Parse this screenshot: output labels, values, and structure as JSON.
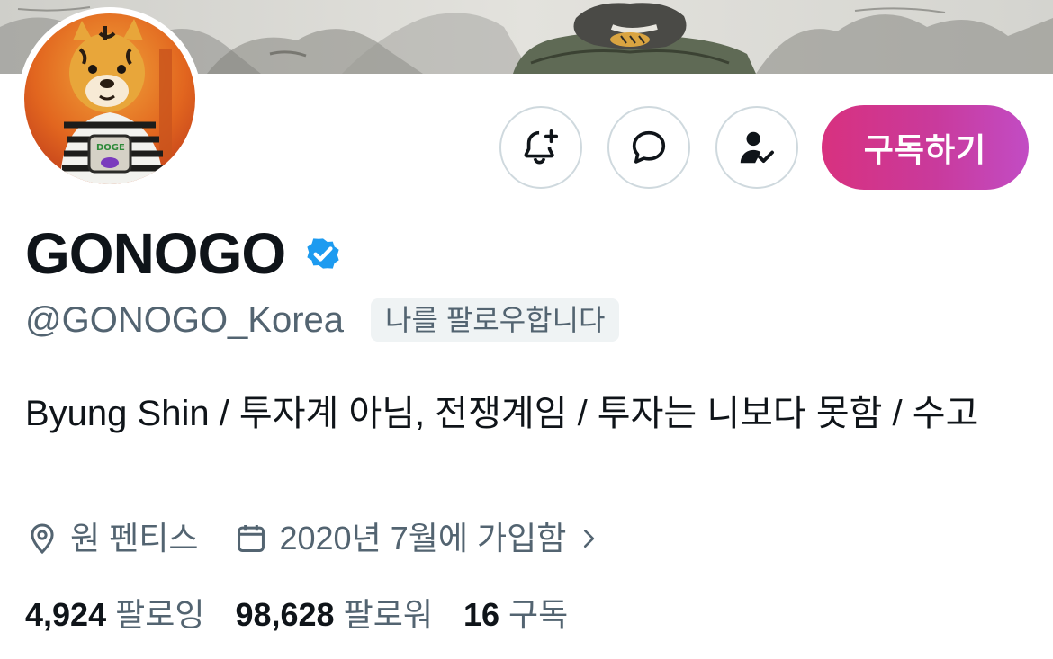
{
  "profile": {
    "display_name": "GONOGO",
    "handle": "@GONOGO_Korea",
    "follows_you_badge": "나를 팔로우합니다",
    "bio": "Byung Shin / 투자계 아님, 전쟁계임 / 투자는 니보다 못함 / 수고",
    "location": "원 펜티스",
    "joined": "2020년 7월에 가입함",
    "verified_icon": "verified-badge-icon",
    "accent_color": "#1d9bf0"
  },
  "actions": {
    "notify_icon": "bell-plus-icon",
    "message_icon": "message-bubble-icon",
    "follow_icon": "person-check-icon",
    "subscribe_label": "구독하기",
    "subscribe_gradient": [
      "#d8317f",
      "#c24cc4"
    ]
  },
  "stats": {
    "following_count": "4,924",
    "following_label": "팔로잉",
    "followers_count": "98,628",
    "followers_label": "팔로워",
    "subscriptions_count": "16",
    "subscriptions_label": "구독"
  },
  "icons": {
    "location": "location-pin-icon",
    "calendar": "calendar-icon",
    "chevron": "chevron-right-icon"
  }
}
